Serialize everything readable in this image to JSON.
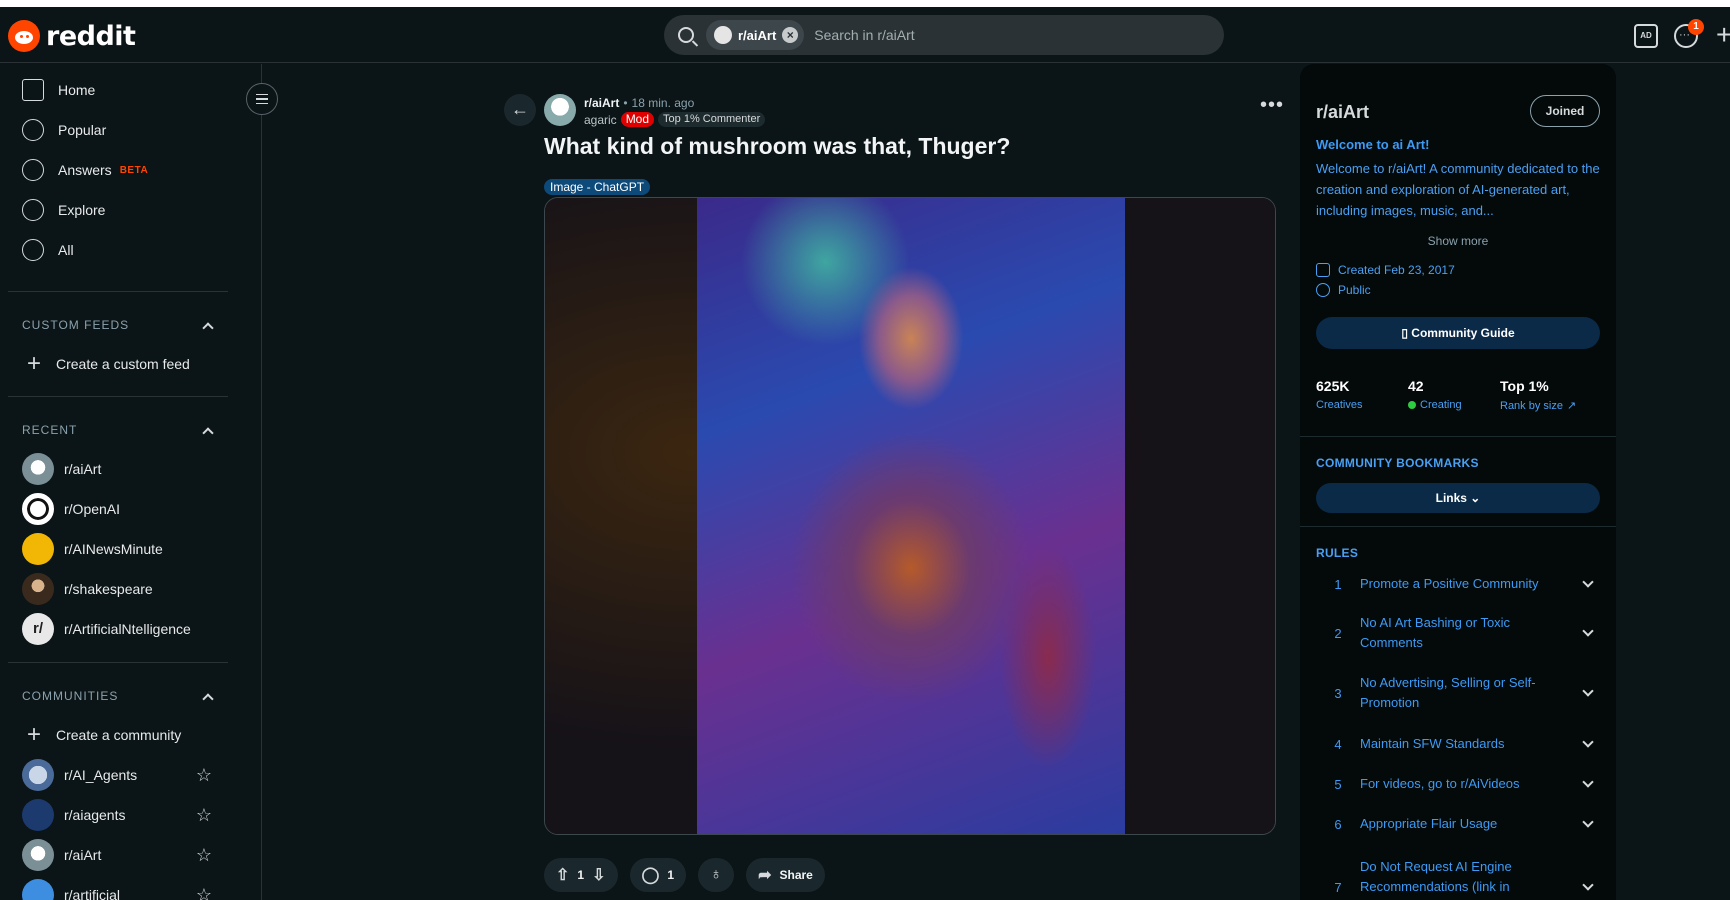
{
  "header": {
    "logo_text": "reddit",
    "search_chip": "r/aiArt",
    "search_placeholder": "Search in r/aiArt",
    "notification_count": "1"
  },
  "sidebar": {
    "nav": [
      {
        "label": "Home",
        "icon": "home-icon"
      },
      {
        "label": "Popular",
        "icon": "popular-icon"
      },
      {
        "label": "Answers",
        "icon": "answers-icon",
        "badge": "BETA"
      },
      {
        "label": "Explore",
        "icon": "explore-icon"
      },
      {
        "label": "All",
        "icon": "all-icon"
      }
    ],
    "custom_feeds": {
      "heading": "CUSTOM FEEDS",
      "create": "Create a custom feed"
    },
    "recent": {
      "heading": "RECENT",
      "items": [
        "r/aiArt",
        "r/OpenAI",
        "r/AINewsMinute",
        "r/shakespeare",
        "r/ArtificialNtelligence"
      ]
    },
    "communities": {
      "heading": "COMMUNITIES",
      "create": "Create a community",
      "items": [
        "r/AI_Agents",
        "r/aiagents",
        "r/aiArt",
        "r/artificial"
      ]
    }
  },
  "post": {
    "subreddit": "r/aiArt",
    "time": "18 min. ago",
    "author": "agaric",
    "mod_label": "Mod",
    "author_flair": "Top 1% Commenter",
    "title": "What kind of mushroom was that, Thuger?",
    "flair": "Image - ChatGPT",
    "votes": "1",
    "comments": "1",
    "share_label": "Share"
  },
  "community": {
    "name": "r/aiArt",
    "joined_label": "Joined",
    "welcome": "Welcome to ai Art!",
    "description": "Welcome to r/aiArt! A community dedicated to the creation and exploration of AI-generated art, including images, music, and...",
    "show_more": "Show more",
    "created": "Created Feb 23, 2017",
    "visibility": "Public",
    "guide_label": "Community Guide",
    "stats": [
      {
        "value": "625K",
        "label": "Creatives"
      },
      {
        "value": "42",
        "label": "Creating"
      },
      {
        "value": "Top 1%",
        "label": "Rank by size"
      }
    ],
    "bookmarks_heading": "COMMUNITY BOOKMARKS",
    "links_label": "Links",
    "rules_heading": "RULES",
    "rules": [
      {
        "n": "1",
        "text": "Promote a Positive Community"
      },
      {
        "n": "2",
        "text": "No AI Art Bashing or Toxic Comments"
      },
      {
        "n": "3",
        "text": "No Advertising, Selling or Self-Promotion"
      },
      {
        "n": "4",
        "text": "Maintain SFW Standards"
      },
      {
        "n": "5",
        "text": "For videos, go to r/AiVideos"
      },
      {
        "n": "6",
        "text": "Appropriate Flair Usage"
      },
      {
        "n": "7",
        "text": "Do Not Request AI Engine Recommendations (link in"
      }
    ]
  },
  "colors": {
    "accent": "#ff4500",
    "link": "#3d9bf5",
    "background": "#0b1416"
  }
}
